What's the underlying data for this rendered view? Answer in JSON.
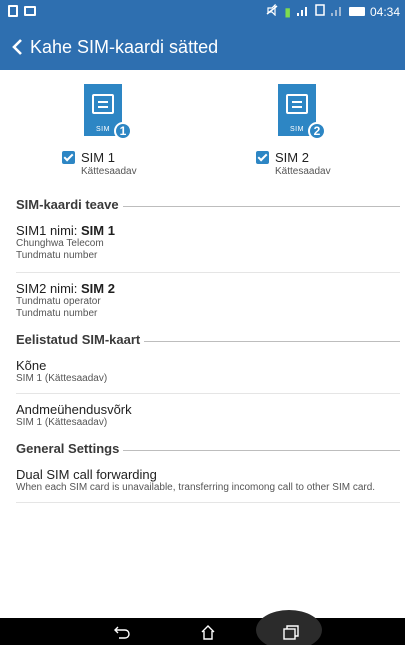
{
  "app": {
    "title": "Kahe SIM-kaardi sätted"
  },
  "status": {
    "time": "04:34"
  },
  "sims": [
    {
      "card_label": "SIM",
      "badge": "1",
      "name": "SIM 1",
      "status": "Kättesaadav",
      "checked": true
    },
    {
      "card_label": "SIM",
      "badge": "2",
      "name": "SIM 2",
      "status": "Kättesaadav",
      "checked": true
    }
  ],
  "sections": {
    "info": "SIM-kaardi teave",
    "preferred": "Eelistatud SIM-kaart",
    "general": "General Settings"
  },
  "info_items": [
    {
      "prefix": "SIM1 nimi: ",
      "value": "SIM 1",
      "line1": "Chunghwa Telecom",
      "line2": "Tundmatu number"
    },
    {
      "prefix": "SIM2 nimi: ",
      "value": "SIM 2",
      "line1": "Tundmatu operator",
      "line2": "Tundmatu number"
    }
  ],
  "preferred_items": [
    {
      "title": "Kõne",
      "sub": "SIM 1 (Kättesaadav)"
    },
    {
      "title": "Andmeühendusvõrk",
      "sub": "SIM 1 (Kättesaadav)"
    }
  ],
  "general_items": [
    {
      "title": "Dual SIM call forwarding",
      "sub": "When each SIM card is unavailable, transferring incomong call to other SIM card."
    }
  ],
  "colors": {
    "primary": "#2e6fb0",
    "accent": "#2d86c4"
  }
}
